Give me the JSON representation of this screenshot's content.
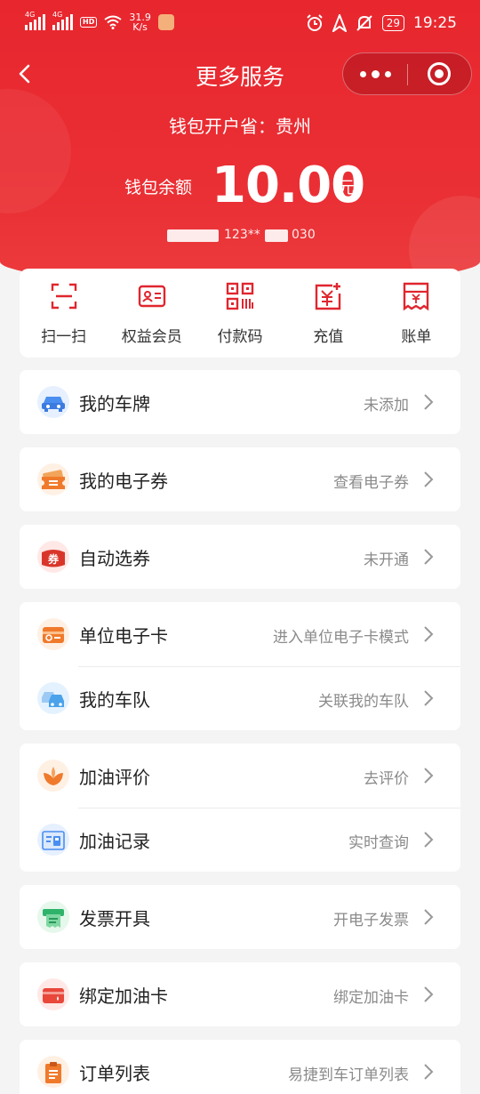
{
  "status_bar": {
    "signal1": "4G",
    "signal2": "4G",
    "hd_badge": "HD",
    "speed": "31.9",
    "speed_unit": "K/s",
    "battery": "29",
    "time": "19:25"
  },
  "header": {
    "title": "更多服务",
    "province": "钱包开户省：贵州",
    "balance_label": "钱包余额",
    "balance_value": "10.00",
    "balance_unit": "元",
    "card_number_partial": "123**",
    "card_number_tail": "030"
  },
  "quick_actions": [
    {
      "label": "扫一扫",
      "icon": "scan-icon"
    },
    {
      "label": "权益会员",
      "icon": "member-card-icon"
    },
    {
      "label": "付款码",
      "icon": "qr-code-icon"
    },
    {
      "label": "充值",
      "icon": "recharge-icon"
    },
    {
      "label": "账单",
      "icon": "bill-icon"
    }
  ],
  "menu": {
    "plate": {
      "label": "我的车牌",
      "hint": "未添加",
      "icon": "car-icon"
    },
    "coupon": {
      "label": "我的电子券",
      "hint": "查看电子券",
      "icon": "coupon-ticket-icon"
    },
    "auto_coupon": {
      "label": "自动选券",
      "hint": "未开通",
      "icon": "voucher-badge-icon",
      "badge_text": "券"
    },
    "company_card": {
      "label": "单位电子卡",
      "hint": "进入单位电子卡模式",
      "icon": "company-card-icon"
    },
    "fleet": {
      "label": "我的车队",
      "hint": "关联我的车队",
      "icon": "fleet-icon"
    },
    "review": {
      "label": "加油评价",
      "hint": "去评价",
      "icon": "flower-rating-icon"
    },
    "records": {
      "label": "加油记录",
      "hint": "实时查询",
      "icon": "fuel-record-icon"
    },
    "invoice": {
      "label": "发票开具",
      "hint": "开电子发票",
      "icon": "invoice-printer-icon"
    },
    "bind_card": {
      "label": "绑定加油卡",
      "hint": "绑定加油卡",
      "icon": "fuel-card-icon"
    },
    "orders": {
      "label": "订单列表",
      "hint": "易捷到车订单列表",
      "icon": "order-clipboard-icon"
    }
  },
  "colors": {
    "brand_red": "#e8262e",
    "hint_gray": "#8a8a8a",
    "page_bg": "#f4f4f4"
  }
}
